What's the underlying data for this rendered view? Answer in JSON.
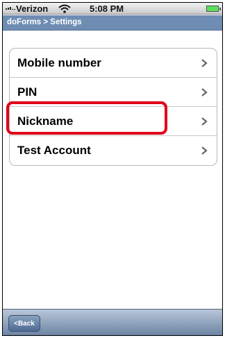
{
  "status_bar": {
    "carrier": "Verizon",
    "time": "5:08 PM",
    "icons": [
      "signal-icon",
      "wifi-icon",
      "battery-icon"
    ]
  },
  "title_bar": {
    "breadcrumb": "doForms > Settings"
  },
  "settings": {
    "items": [
      {
        "label": "Mobile number"
      },
      {
        "label": "PIN"
      },
      {
        "label": "Nickname"
      },
      {
        "label": "Test Account"
      }
    ],
    "highlighted_item": "Nickname"
  },
  "toolbar": {
    "back_label": "<Back"
  },
  "colors": {
    "title_bar": "#6f8db3",
    "highlight": "#e0001a",
    "toolbar": "#6d84a3"
  }
}
